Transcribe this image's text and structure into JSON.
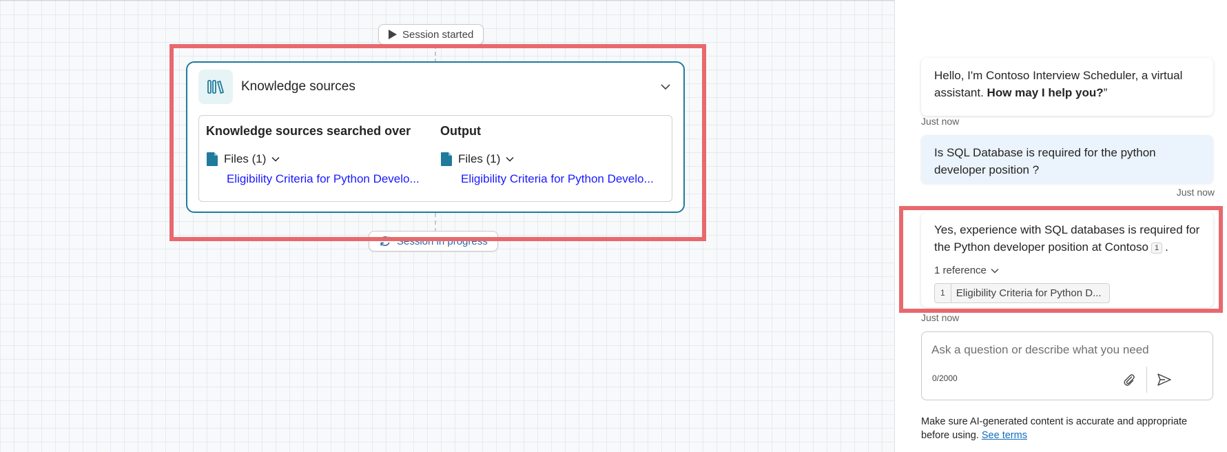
{
  "canvas": {
    "session_started": "Session started",
    "session_in_progress": "Session in progress",
    "knowledge_card": {
      "title": "Knowledge sources",
      "left_heading": "Knowledge sources searched over",
      "right_heading": "Output",
      "left_files_label": "Files (1)",
      "right_files_label": "Files (1)",
      "left_file_link": "Eligibility Criteria for Python Develo...",
      "right_file_link": "Eligibility Criteria for Python Develo..."
    }
  },
  "chat": {
    "messages": [
      {
        "role": "bot",
        "text_plain": "Hello, I'm Contoso Interview Scheduler, a virtual assistant. ",
        "text_bold": "How may I help you?",
        "text_tail": "”",
        "timestamp": "Just now"
      },
      {
        "role": "user",
        "text": "Is SQL Database is required for the python developer position ?",
        "timestamp": "Just now"
      },
      {
        "role": "bot",
        "text": "Yes, experience with SQL databases is required for the Python developer position at Contoso",
        "citation": "1",
        "text_end": ".",
        "references_label": "1 reference",
        "reference_number": "1",
        "reference_title": "Eligibility Criteria for Python D...",
        "timestamp": "Just now"
      }
    ],
    "input": {
      "placeholder": "Ask a question or describe what you need",
      "value": "",
      "char_count": "0/2000"
    },
    "disclaimer": "Make sure AI-generated content is accurate and appropriate before using. ",
    "terms_link": "See terms"
  },
  "colors": {
    "accent_teal": "#1f7a9c",
    "highlight_red": "#e8696d",
    "link_blue": "#1a1aff",
    "user_bubble": "#ebf3fc"
  }
}
